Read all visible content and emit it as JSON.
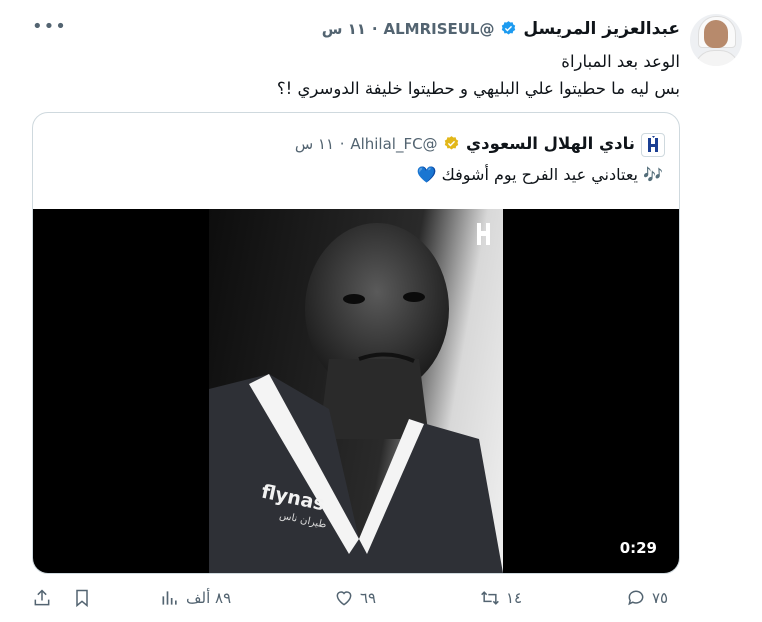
{
  "tweet": {
    "author_name": "عبدالعزيز المريسل",
    "handle": "@ALMRISEUL",
    "time": "١١ س",
    "separator": "·",
    "text_line1": "الوعد بعد المباراة",
    "text_line2": "بس ليه ما حطيتوا علي البليهي و حطيتوا خليفة الدوسري !؟"
  },
  "quote": {
    "author_name": "نادي الهلال السعودي",
    "handle": "@Alhilal_FC",
    "time": "١١ س",
    "separator": "·",
    "text": "🎶 يعتادني عيد الفرح يوم أشوفك 💙",
    "video_duration": "0:29",
    "jersey_text": "flynas",
    "jersey_subtext": "طيران ناس"
  },
  "actions": {
    "replies": "٧٥",
    "reposts": "١٤",
    "likes": "٦٩",
    "views": "٨٩ ألف"
  },
  "colors": {
    "verified_blue": "#1d9bf0",
    "verified_gold": "#e2b719",
    "muted_text": "#536471",
    "hilal_blue": "#1b3f93"
  }
}
